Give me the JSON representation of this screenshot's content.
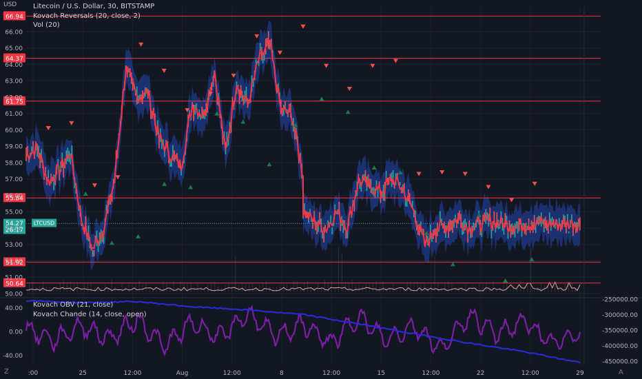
{
  "header": {
    "currency": "USD",
    "title": "Litecoin / U.S. Dollar, 30, BITSTAMP",
    "indicator1": "Kovach Reversals (20, close, 2)",
    "indicator2": "Vol (20)"
  },
  "lower_pane": {
    "indicator1": "Kovach OBV (21, close)",
    "indicator2": "Kovach Chande (14, close, open)"
  },
  "footer": {
    "z_button": "Z",
    "a_button": "A"
  },
  "price_badge": {
    "price": "54.27",
    "countdown": "26:17",
    "symbol": "LTCUSD"
  },
  "colors": {
    "background": "#131722",
    "line_red": "#f23645",
    "band": "#1e3a8a",
    "up": "#26a69a",
    "down": "#ef5350",
    "obv": "#2929d6",
    "chande": "#7b1fa2"
  },
  "chart_data": [
    {
      "type": "line",
      "title": "Litecoin / U.S. Dollar, 30, BITSTAMP",
      "ylabel": "USD",
      "ylim": [
        50.0,
        67.0
      ],
      "y_ticks": [
        "66.00",
        "65.00",
        "64.00",
        "63.00",
        "62.00",
        "61.00",
        "60.00",
        "59.00",
        "58.00",
        "57.00",
        "56.00",
        "55.00",
        "54.00",
        "53.00",
        "52.00",
        "51.00",
        "50.00"
      ],
      "x_ticks": [
        ":00",
        "25",
        "12:00",
        "Aug",
        "12:00",
        "8",
        "12:00",
        "15",
        "12:00",
        "22",
        "12:00",
        "29"
      ],
      "horizontal_levels": [
        "66.94",
        "64.37",
        "61.75",
        "55.84",
        "51.92",
        "50.64"
      ],
      "series": [
        {
          "name": "",
          "x": [
            0,
            4,
            8,
            12,
            16,
            20,
            24,
            28,
            32,
            36,
            40,
            44,
            48,
            52,
            56,
            60,
            64,
            68,
            72,
            76,
            80,
            84,
            88,
            92,
            96,
            100
          ],
          "values": [
            58.4,
            58.9,
            56.8,
            57.6,
            58.6,
            54.5,
            52.7,
            54.0,
            57.0,
            63.8,
            62.0,
            62.3,
            59.5,
            58.5,
            57.8,
            61.6,
            60.9,
            63.6,
            58.6,
            62.9,
            61.5,
            64.3,
            65.2,
            61.2,
            60.9,
            57.2
          ]
        },
        {
          "name": "",
          "x": [
            100,
            104,
            108,
            112,
            116,
            120,
            124,
            128,
            132,
            136,
            140,
            144,
            148,
            152,
            156,
            160,
            164,
            168,
            172,
            176,
            180,
            184,
            188,
            192,
            196,
            200
          ],
          "values": [
            55.0,
            54.4,
            53.9,
            55.0,
            54.1,
            56.9,
            56.6,
            56.2,
            57.0,
            56.4,
            55.0,
            52.9,
            54.0,
            54.1,
            54.6,
            54.0,
            54.3,
            54.4,
            54.3,
            54.1,
            54.2,
            54.3,
            54.3,
            54.2,
            54.3,
            54.27
          ]
        }
      ],
      "sell_signals_y": [
        59.0,
        59.3,
        55.5,
        56.0,
        64.1,
        62.5,
        60.1,
        61.1,
        62.2,
        64.6,
        63.6,
        65.2,
        62.8,
        61.4,
        62.8,
        63.1,
        56.2,
        56.3,
        56.2,
        55.4,
        54.6,
        55.6
      ],
      "buy_signals_y": [
        58.8,
        57.2,
        54.2,
        54.6,
        57.8,
        57.6,
        62.1,
        61.6,
        59.0,
        61.4,
        63.0,
        62.2,
        58.8,
        58.5,
        54.8,
        52.9,
        55.9,
        51.9,
        53.2
      ],
      "current_price": "54.27"
    },
    {
      "type": "line",
      "title": "",
      "ylim": [
        -50,
        50
      ],
      "y_ticks": [
        "40.00",
        "0.00",
        "-40.00"
      ],
      "y2_ticks": [
        "-250000.00",
        "-300000.00",
        "-350000.00",
        "-400000.00",
        "-450000.00"
      ],
      "series": [
        {
          "name": "Kovach OBV (21, close)",
          "x": [
            0,
            10,
            20,
            30,
            40,
            50,
            60,
            70,
            80,
            90,
            100
          ],
          "values": [
            -255000,
            -262000,
            -258000,
            -275000,
            -285000,
            -300000,
            -330000,
            -362000,
            -392000,
            -420000,
            -455000
          ]
        },
        {
          "name": "Kovach Chande (14, close, open)",
          "x": [
            0,
            5,
            10,
            15,
            20,
            25,
            30,
            35,
            40,
            45,
            50,
            55,
            60,
            65,
            70,
            75,
            80,
            85,
            90,
            95,
            100
          ],
          "values": [
            5,
            -15,
            10,
            -12,
            20,
            -25,
            15,
            -10,
            30,
            -8,
            12,
            -20,
            25,
            -15,
            10,
            -30,
            28,
            -5,
            18,
            -22,
            0
          ]
        }
      ]
    }
  ]
}
